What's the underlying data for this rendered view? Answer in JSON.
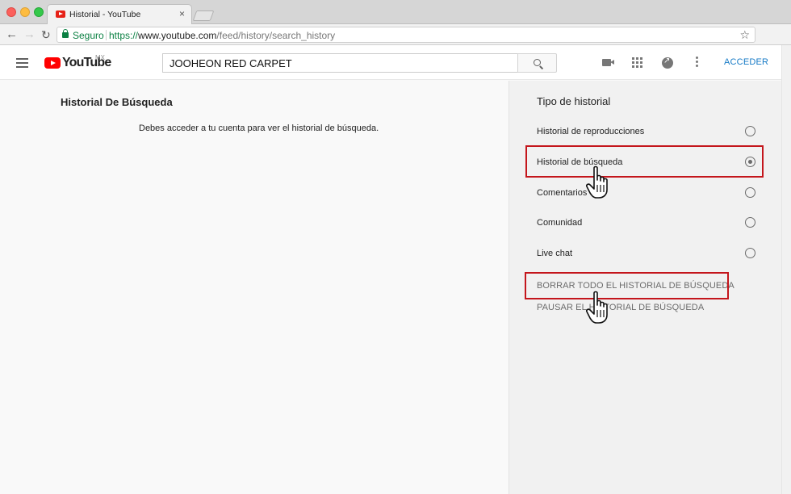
{
  "browser": {
    "tab_title": "Historial - YouTube",
    "tab_close": "×",
    "secure_label": "Seguro",
    "url_scheme": "https://",
    "url_host": "www.youtube.com",
    "url_path": "/feed/history/search_history",
    "icons": [
      "back-arrow-icon",
      "forward-arrow-icon",
      "reload-icon",
      "lock-icon",
      "star-icon",
      "extension-icon",
      "menu-dots-icon"
    ]
  },
  "header": {
    "logo_text": "YouTube",
    "country_code": "MX",
    "search_value": "JOOHEON RED CARPET",
    "signin_label": "ACCEDER",
    "accent_color": "#167ac6",
    "brand_color": "#ff0000",
    "icons": [
      "hamburger-icon",
      "search-icon",
      "upload-video-icon",
      "apps-grid-icon",
      "share-icon",
      "more-vert-icon"
    ]
  },
  "main": {
    "title": "Historial De Búsqueda",
    "message": "Debes acceder a tu cuenta para ver el historial de búsqueda."
  },
  "side": {
    "title": "Tipo de historial",
    "options": [
      {
        "label": "Historial de reproducciones",
        "checked": false
      },
      {
        "label": "Historial de búsqueda",
        "checked": true
      },
      {
        "label": "Comentarios",
        "checked": false
      },
      {
        "label": "Comunidad",
        "checked": false
      },
      {
        "label": "Live chat",
        "checked": false
      }
    ],
    "actions": {
      "clear": "BORRAR TODO EL HISTORIAL DE BÚSQUEDA",
      "pause": "PAUSAR EL HISTORIAL DE BÚSQUEDA"
    }
  },
  "annotations": {
    "highlight_color": "#c4161c",
    "cursor_icon": "hand-pointer-icon"
  }
}
